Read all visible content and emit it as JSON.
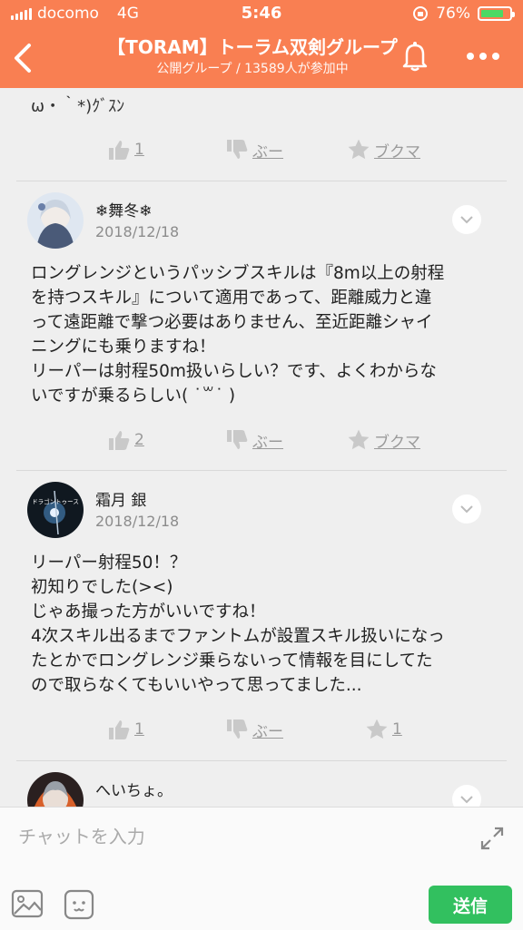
{
  "status": {
    "carrier": "docomo",
    "network": "4G",
    "time": "5:46",
    "battery": "76%"
  },
  "header": {
    "title": "【TORAM】トーラム双剣グループ",
    "subtitle": "公開グループ / 13589人が参加中",
    "icons": [
      "back-icon",
      "bell-icon",
      "more-icon"
    ]
  },
  "feed": {
    "prev_text": "ω・｀*)ｸﾞｽﾝ",
    "prev_actions": {
      "like": "1",
      "dislike": "ぶー",
      "bookmark": "ブクマ"
    },
    "comments": [
      {
        "user": "❄舞冬❄",
        "date": "2018/12/18",
        "text": "ロングレンジというパッシブスキルは『8m以上の射程\nを持つスキル』について適用であって、距離威力と違\nって遠距離で撃つ必要はありません、至近距離シャイ\nニングにも乗りますね！\nリーパーは射程50m扱いらしい？です、よくわからな\nいですが乗るらしい( ˙꒳˙ )",
        "actions": {
          "like": "2",
          "dislike": "ぶー",
          "bookmark": "ブクマ"
        }
      },
      {
        "user": "霜月 銀",
        "date": "2018/12/18",
        "avatar_text": "ドラゴントゥース",
        "text": "リーパー射程50！？\n初知りでした(><)\nじゃあ撮った方がいいですね！\n4次スキル出るまでファントムが設置スキル扱いになっ\nたとかでロングレンジ乗らないって情報を目にしてた\nので取らなくてもいいやって思ってました...",
        "actions": {
          "like": "1",
          "dislike": "ぶー",
          "bookmark": "1"
        }
      },
      {
        "user": "へいちょ。"
      }
    ]
  },
  "input": {
    "placeholder": "チャットを入力",
    "send": "送信"
  },
  "colors": {
    "header": "#f97f52",
    "send": "#32c05f",
    "battery": "#4cd964"
  }
}
